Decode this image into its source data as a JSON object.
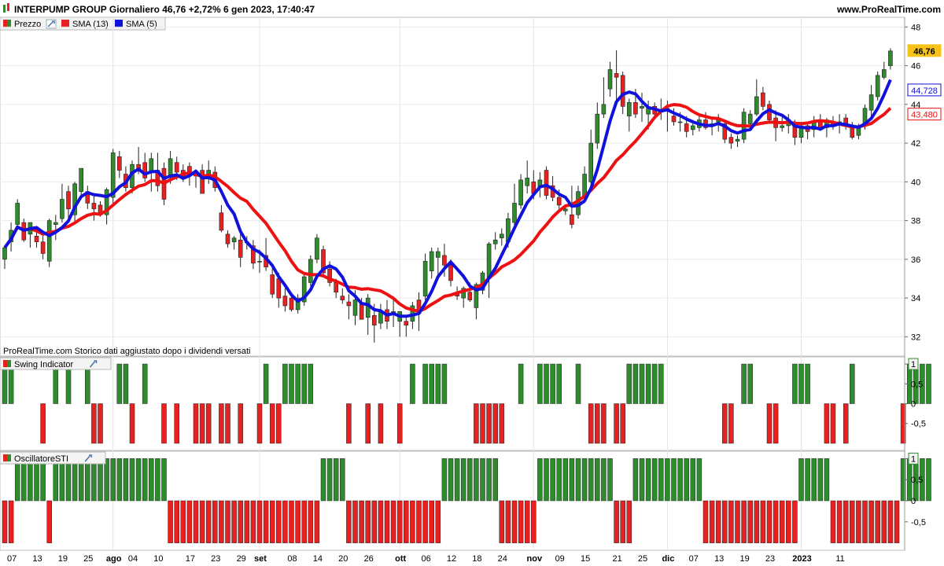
{
  "header": {
    "title": "INTERPUMP GROUP Giornaliero 46,76 +2,72% 6 gen 2023, 17:40:47",
    "site": "www.ProRealTime.com"
  },
  "legend": {
    "prezzo": "Prezzo",
    "sma13": "SMA (13)",
    "sma5": "SMA (5)"
  },
  "footnote": "ProRealTime.com  Storico dati aggiustato dopo i dividendi versati",
  "colors": {
    "up": "#2e8b2e",
    "down": "#e82020",
    "sma13": "#ee1111",
    "sma5": "#1111dd",
    "last_price_bg": "#f7c21a"
  },
  "chart_data": [
    {
      "type": "candlestick",
      "title": "INTERPUMP GROUP Giornaliero",
      "ylim": [
        31,
        48.5
      ],
      "y_ticks": [
        "48",
        "46",
        "44",
        "42",
        "40",
        "38",
        "36",
        "34",
        "32"
      ],
      "last_price_label": "46,76",
      "sma5_label": "44,728",
      "sma13_label": "43,480",
      "x_tick_labels": [
        "07",
        "13",
        "19",
        "25",
        "ago",
        "04",
        "10",
        "17",
        "23",
        "29",
        "set",
        "08",
        "14",
        "20",
        "26",
        "ott",
        "06",
        "12",
        "18",
        "24",
        "nov",
        "09",
        "15",
        "21",
        "25",
        "dic",
        "07",
        "13",
        "19",
        "23",
        "2023",
        "11"
      ],
      "candles": [
        {
          "o": 36.0,
          "h": 36.6,
          "l": 35.5,
          "c": 36.6
        },
        {
          "o": 36.9,
          "h": 37.9,
          "l": 36.4,
          "c": 37.5
        },
        {
          "o": 37.8,
          "h": 39.1,
          "l": 37.5,
          "c": 38.9
        },
        {
          "o": 37.9,
          "h": 38.1,
          "l": 36.9,
          "c": 37.0
        },
        {
          "o": 37.3,
          "h": 37.9,
          "l": 36.6,
          "c": 37.9
        },
        {
          "o": 37.2,
          "h": 37.5,
          "l": 36.6,
          "c": 36.9
        },
        {
          "o": 36.9,
          "h": 37.3,
          "l": 36.0,
          "c": 36.3
        },
        {
          "o": 35.9,
          "h": 38.1,
          "l": 35.6,
          "c": 38.0
        },
        {
          "o": 37.8,
          "h": 38.3,
          "l": 37.0,
          "c": 37.9
        },
        {
          "o": 38.1,
          "h": 39.9,
          "l": 37.9,
          "c": 39.1
        },
        {
          "o": 39.5,
          "h": 39.8,
          "l": 38.1,
          "c": 38.6
        },
        {
          "o": 38.3,
          "h": 40.0,
          "l": 37.8,
          "c": 39.9
        },
        {
          "o": 39.5,
          "h": 40.7,
          "l": 39.1,
          "c": 40.7
        },
        {
          "o": 39.5,
          "h": 39.8,
          "l": 38.6,
          "c": 38.9
        },
        {
          "o": 38.9,
          "h": 39.3,
          "l": 38.0,
          "c": 38.6
        },
        {
          "o": 38.8,
          "h": 39.0,
          "l": 38.2,
          "c": 38.4
        },
        {
          "o": 38.3,
          "h": 39.7,
          "l": 37.8,
          "c": 39.6
        },
        {
          "o": 39.2,
          "h": 41.7,
          "l": 38.9,
          "c": 41.5
        },
        {
          "o": 41.3,
          "h": 41.6,
          "l": 40.2,
          "c": 40.6
        },
        {
          "o": 40.4,
          "h": 40.8,
          "l": 39.5,
          "c": 39.7
        },
        {
          "o": 39.7,
          "h": 41.1,
          "l": 39.4,
          "c": 40.9
        },
        {
          "o": 40.9,
          "h": 41.8,
          "l": 40.4,
          "c": 40.6
        },
        {
          "o": 41.0,
          "h": 41.5,
          "l": 40.0,
          "c": 40.2
        },
        {
          "o": 40.5,
          "h": 41.5,
          "l": 39.5,
          "c": 41.2
        },
        {
          "o": 40.6,
          "h": 41.5,
          "l": 39.5,
          "c": 39.8
        },
        {
          "o": 40.7,
          "h": 41.0,
          "l": 38.8,
          "c": 39.1
        },
        {
          "o": 40.3,
          "h": 41.6,
          "l": 39.9,
          "c": 41.2
        },
        {
          "o": 41.0,
          "h": 41.3,
          "l": 40.1,
          "c": 40.5
        },
        {
          "o": 40.6,
          "h": 40.9,
          "l": 40.0,
          "c": 40.3
        },
        {
          "o": 40.8,
          "h": 41.0,
          "l": 39.8,
          "c": 40.5
        },
        {
          "o": 40.4,
          "h": 40.6,
          "l": 39.7,
          "c": 40.3
        },
        {
          "o": 40.6,
          "h": 40.9,
          "l": 39.4,
          "c": 39.4
        },
        {
          "o": 40.4,
          "h": 41.1,
          "l": 39.9,
          "c": 40.6
        },
        {
          "o": 40.5,
          "h": 40.8,
          "l": 39.5,
          "c": 39.7
        },
        {
          "o": 38.4,
          "h": 38.8,
          "l": 37.4,
          "c": 37.5
        },
        {
          "o": 37.3,
          "h": 37.5,
          "l": 36.6,
          "c": 36.8
        },
        {
          "o": 36.9,
          "h": 37.2,
          "l": 36.5,
          "c": 37.1
        },
        {
          "o": 37.0,
          "h": 37.3,
          "l": 35.6,
          "c": 36.1
        },
        {
          "o": 36.9,
          "h": 37.2,
          "l": 36.5,
          "c": 36.9
        },
        {
          "o": 36.7,
          "h": 37.0,
          "l": 35.5,
          "c": 35.8
        },
        {
          "o": 35.9,
          "h": 36.5,
          "l": 35.3,
          "c": 35.9
        },
        {
          "o": 36.2,
          "h": 37.1,
          "l": 35.4,
          "c": 35.6
        },
        {
          "o": 35.2,
          "h": 35.6,
          "l": 34.0,
          "c": 34.2
        },
        {
          "o": 35.0,
          "h": 35.3,
          "l": 33.5,
          "c": 34.0
        },
        {
          "o": 34.1,
          "h": 34.5,
          "l": 33.3,
          "c": 33.6
        },
        {
          "o": 34.0,
          "h": 34.3,
          "l": 33.3,
          "c": 33.4
        },
        {
          "o": 33.4,
          "h": 34.2,
          "l": 33.2,
          "c": 34.0
        },
        {
          "o": 33.8,
          "h": 35.3,
          "l": 33.6,
          "c": 35.1
        },
        {
          "o": 34.8,
          "h": 36.2,
          "l": 34.6,
          "c": 36.0
        },
        {
          "o": 36.0,
          "h": 37.3,
          "l": 35.8,
          "c": 37.1
        },
        {
          "o": 36.5,
          "h": 36.7,
          "l": 35.1,
          "c": 35.3
        },
        {
          "o": 35.5,
          "h": 35.9,
          "l": 34.6,
          "c": 34.8
        },
        {
          "o": 34.8,
          "h": 35.0,
          "l": 34.0,
          "c": 34.3
        },
        {
          "o": 34.1,
          "h": 34.5,
          "l": 33.7,
          "c": 33.9
        },
        {
          "o": 33.8,
          "h": 34.2,
          "l": 32.9,
          "c": 33.6
        },
        {
          "o": 33.1,
          "h": 34.4,
          "l": 32.6,
          "c": 33.9
        },
        {
          "o": 33.7,
          "h": 34.0,
          "l": 32.9,
          "c": 32.9
        },
        {
          "o": 33.0,
          "h": 34.2,
          "l": 32.1,
          "c": 34.0
        },
        {
          "o": 33.1,
          "h": 33.7,
          "l": 31.7,
          "c": 32.6
        },
        {
          "o": 32.7,
          "h": 33.7,
          "l": 32.4,
          "c": 33.3
        },
        {
          "o": 33.4,
          "h": 33.9,
          "l": 32.4,
          "c": 32.8
        },
        {
          "o": 33.2,
          "h": 33.9,
          "l": 32.5,
          "c": 33.3
        },
        {
          "o": 32.8,
          "h": 33.3,
          "l": 32.0,
          "c": 33.3
        },
        {
          "o": 32.8,
          "h": 33.0,
          "l": 32.0,
          "c": 32.6
        },
        {
          "o": 32.8,
          "h": 33.8,
          "l": 32.4,
          "c": 33.6
        },
        {
          "o": 33.9,
          "h": 34.3,
          "l": 32.3,
          "c": 33.2
        },
        {
          "o": 34.1,
          "h": 36.3,
          "l": 33.9,
          "c": 35.9
        },
        {
          "o": 35.4,
          "h": 36.6,
          "l": 35.0,
          "c": 36.4
        },
        {
          "o": 36.1,
          "h": 36.6,
          "l": 35.2,
          "c": 36.4
        },
        {
          "o": 36.2,
          "h": 36.8,
          "l": 35.1,
          "c": 35.7
        },
        {
          "o": 35.7,
          "h": 36.0,
          "l": 34.6,
          "c": 34.9
        },
        {
          "o": 34.3,
          "h": 34.6,
          "l": 33.9,
          "c": 34.1
        },
        {
          "o": 34.0,
          "h": 34.6,
          "l": 33.5,
          "c": 34.5
        },
        {
          "o": 34.3,
          "h": 34.8,
          "l": 33.8,
          "c": 33.9
        },
        {
          "o": 33.5,
          "h": 34.8,
          "l": 32.9,
          "c": 34.7
        },
        {
          "o": 34.4,
          "h": 35.4,
          "l": 34.2,
          "c": 35.3
        },
        {
          "o": 35.0,
          "h": 36.9,
          "l": 34.0,
          "c": 36.8
        },
        {
          "o": 36.8,
          "h": 37.4,
          "l": 36.5,
          "c": 37.0
        },
        {
          "o": 37.1,
          "h": 37.6,
          "l": 36.7,
          "c": 37.3
        },
        {
          "o": 36.9,
          "h": 38.4,
          "l": 36.6,
          "c": 38.1
        },
        {
          "o": 37.9,
          "h": 39.9,
          "l": 37.6,
          "c": 38.9
        },
        {
          "o": 38.8,
          "h": 40.4,
          "l": 38.6,
          "c": 40.1
        },
        {
          "o": 39.8,
          "h": 41.1,
          "l": 39.4,
          "c": 40.2
        },
        {
          "o": 40.0,
          "h": 40.6,
          "l": 39.1,
          "c": 39.4
        },
        {
          "o": 39.7,
          "h": 40.5,
          "l": 39.2,
          "c": 40.1
        },
        {
          "o": 40.6,
          "h": 40.8,
          "l": 39.1,
          "c": 39.3
        },
        {
          "o": 39.8,
          "h": 40.3,
          "l": 39.0,
          "c": 39.2
        },
        {
          "o": 39.2,
          "h": 39.6,
          "l": 38.6,
          "c": 38.8
        },
        {
          "o": 38.5,
          "h": 38.8,
          "l": 38.3,
          "c": 38.6
        },
        {
          "o": 38.3,
          "h": 39.8,
          "l": 37.6,
          "c": 37.8
        },
        {
          "o": 38.3,
          "h": 39.8,
          "l": 38.1,
          "c": 39.5
        },
        {
          "o": 39.3,
          "h": 40.8,
          "l": 38.9,
          "c": 40.4
        },
        {
          "o": 40.0,
          "h": 42.7,
          "l": 39.8,
          "c": 42.0
        },
        {
          "o": 42.0,
          "h": 44.1,
          "l": 41.7,
          "c": 43.5
        },
        {
          "o": 43.5,
          "h": 45.4,
          "l": 43.3,
          "c": 44.0
        },
        {
          "o": 44.8,
          "h": 46.2,
          "l": 44.4,
          "c": 45.8
        },
        {
          "o": 45.6,
          "h": 46.8,
          "l": 44.1,
          "c": 45.4
        },
        {
          "o": 45.5,
          "h": 45.7,
          "l": 43.5,
          "c": 43.9
        },
        {
          "o": 43.4,
          "h": 44.3,
          "l": 42.6,
          "c": 44.1
        },
        {
          "o": 44.1,
          "h": 44.8,
          "l": 43.3,
          "c": 43.5
        },
        {
          "o": 43.8,
          "h": 44.6,
          "l": 43.1,
          "c": 43.9
        },
        {
          "o": 43.5,
          "h": 44.2,
          "l": 42.7,
          "c": 43.8
        },
        {
          "o": 43.9,
          "h": 44.1,
          "l": 43.3,
          "c": 43.5
        },
        {
          "o": 43.7,
          "h": 44.3,
          "l": 43.2,
          "c": 43.6
        },
        {
          "o": 43.8,
          "h": 44.2,
          "l": 42.6,
          "c": 43.8
        },
        {
          "o": 43.4,
          "h": 43.8,
          "l": 42.9,
          "c": 43.1
        },
        {
          "o": 43.1,
          "h": 43.6,
          "l": 42.6,
          "c": 43.1
        },
        {
          "o": 43.0,
          "h": 43.4,
          "l": 42.3,
          "c": 42.6
        },
        {
          "o": 42.7,
          "h": 43.2,
          "l": 42.4,
          "c": 42.9
        },
        {
          "o": 42.8,
          "h": 43.4,
          "l": 42.6,
          "c": 43.2
        },
        {
          "o": 43.2,
          "h": 43.6,
          "l": 42.7,
          "c": 42.8
        },
        {
          "o": 42.9,
          "h": 43.3,
          "l": 42.4,
          "c": 43.0
        },
        {
          "o": 43.1,
          "h": 43.5,
          "l": 42.6,
          "c": 43.2
        },
        {
          "o": 43.0,
          "h": 43.1,
          "l": 42.0,
          "c": 42.2
        },
        {
          "o": 42.3,
          "h": 42.5,
          "l": 41.7,
          "c": 42.0
        },
        {
          "o": 42.1,
          "h": 42.4,
          "l": 41.8,
          "c": 42.2
        },
        {
          "o": 42.2,
          "h": 43.8,
          "l": 42.0,
          "c": 43.6
        },
        {
          "o": 43.0,
          "h": 43.7,
          "l": 42.8,
          "c": 43.5
        },
        {
          "o": 43.5,
          "h": 45.3,
          "l": 43.4,
          "c": 44.4
        },
        {
          "o": 44.6,
          "h": 44.9,
          "l": 43.7,
          "c": 43.9
        },
        {
          "o": 44.0,
          "h": 44.2,
          "l": 43.0,
          "c": 43.2
        },
        {
          "o": 43.3,
          "h": 43.7,
          "l": 42.1,
          "c": 42.8
        },
        {
          "o": 42.8,
          "h": 43.4,
          "l": 42.6,
          "c": 42.9
        },
        {
          "o": 42.9,
          "h": 43.5,
          "l": 42.5,
          "c": 43.2
        },
        {
          "o": 43.0,
          "h": 43.2,
          "l": 41.9,
          "c": 42.3
        },
        {
          "o": 42.3,
          "h": 43.1,
          "l": 42.0,
          "c": 42.9
        },
        {
          "o": 42.9,
          "h": 43.1,
          "l": 42.2,
          "c": 42.6
        },
        {
          "o": 42.7,
          "h": 43.4,
          "l": 42.3,
          "c": 43.1
        },
        {
          "o": 43.2,
          "h": 43.5,
          "l": 42.7,
          "c": 42.7
        },
        {
          "o": 42.8,
          "h": 43.3,
          "l": 42.3,
          "c": 43.2
        },
        {
          "o": 43.1,
          "h": 43.4,
          "l": 42.7,
          "c": 42.9
        },
        {
          "o": 43.0,
          "h": 43.5,
          "l": 42.5,
          "c": 43.1
        },
        {
          "o": 43.3,
          "h": 43.5,
          "l": 42.7,
          "c": 42.9
        },
        {
          "o": 42.8,
          "h": 43.1,
          "l": 42.2,
          "c": 42.3
        },
        {
          "o": 42.4,
          "h": 43.0,
          "l": 42.2,
          "c": 42.9
        },
        {
          "o": 42.9,
          "h": 44.0,
          "l": 42.7,
          "c": 43.8
        },
        {
          "o": 43.7,
          "h": 45.0,
          "l": 43.3,
          "c": 44.5
        },
        {
          "o": 44.4,
          "h": 45.7,
          "l": 44.2,
          "c": 45.5
        },
        {
          "o": 45.4,
          "h": 46.2,
          "l": 45.3,
          "c": 45.8
        },
        {
          "o": 46.0,
          "h": 46.9,
          "l": 45.8,
          "c": 46.76
        }
      ],
      "sma13_line_hint": "SMA (13)",
      "sma5_line_hint": "SMA (5)"
    },
    {
      "type": "bar",
      "title": "Swing Indicator",
      "ylim": [
        -1.1,
        1.1
      ],
      "y_ticks": [
        "1",
        "0,5",
        "0",
        "-0,5"
      ],
      "values": [
        1,
        1,
        0,
        0,
        0,
        0,
        -1,
        0,
        1,
        0,
        1,
        0,
        0,
        1,
        -1,
        -1,
        0,
        0,
        1,
        1,
        -1,
        0,
        1,
        0,
        0,
        -1,
        0,
        -1,
        0,
        0,
        -1,
        -1,
        -1,
        0,
        -1,
        -1,
        0,
        -1,
        0,
        0,
        -1,
        1,
        -1,
        -1,
        1,
        1,
        1,
        1,
        1,
        0,
        0,
        0,
        0,
        0,
        -1,
        0,
        0,
        -1,
        0,
        -1,
        0,
        0,
        -1,
        0,
        1,
        0,
        1,
        1,
        1,
        1,
        0,
        0,
        0,
        0,
        -1,
        -1,
        -1,
        -1,
        -1,
        0,
        0,
        1,
        0,
        0,
        1,
        1,
        1,
        1,
        0,
        0,
        1,
        0,
        -1,
        -1,
        -1,
        0,
        -1,
        -1,
        1,
        1,
        1,
        1,
        1,
        1,
        0,
        0,
        0,
        0,
        0,
        0,
        0,
        0,
        0,
        -1,
        -1,
        0,
        1,
        1,
        0,
        0,
        -1,
        -1,
        0,
        0,
        1,
        1,
        1,
        0,
        0,
        -1,
        -1,
        0,
        -1,
        1,
        0,
        0,
        0,
        0,
        0,
        0,
        0,
        -1,
        1,
        1,
        1,
        1
      ]
    },
    {
      "type": "bar",
      "title": "OscillatoreSTI",
      "ylim": [
        -1.1,
        1.1
      ],
      "y_ticks": [
        "1",
        "0,5",
        "0",
        "-0,5"
      ],
      "values": [
        -1,
        -1,
        1,
        1,
        1,
        1,
        1,
        -1,
        1,
        1,
        1,
        1,
        1,
        1,
        1,
        1,
        1,
        1,
        1,
        1,
        1,
        1,
        1,
        1,
        1,
        1,
        -1,
        -1,
        -1,
        -1,
        -1,
        -1,
        -1,
        -1,
        -1,
        -1,
        -1,
        -1,
        -1,
        -1,
        -1,
        -1,
        -1,
        -1,
        -1,
        -1,
        -1,
        -1,
        -1,
        -1,
        1,
        1,
        1,
        1,
        -1,
        -1,
        -1,
        -1,
        -1,
        -1,
        -1,
        -1,
        -1,
        -1,
        -1,
        -1,
        -1,
        -1,
        -1,
        1,
        1,
        1,
        1,
        1,
        1,
        1,
        1,
        1,
        -1,
        -1,
        -1,
        -1,
        -1,
        -1,
        1,
        1,
        1,
        1,
        1,
        1,
        1,
        1,
        1,
        1,
        1,
        1,
        -1,
        -1,
        -1,
        1,
        1,
        1,
        1,
        1,
        1,
        1,
        1,
        1,
        1,
        1,
        -1,
        -1,
        -1,
        -1,
        -1,
        -1,
        -1,
        -1,
        -1,
        -1,
        -1,
        -1,
        -1,
        -1,
        -1,
        1,
        1,
        1,
        1,
        1,
        -1,
        -1,
        -1,
        -1,
        -1,
        -1,
        -1,
        -1,
        -1,
        -1,
        -1,
        1,
        1,
        1,
        1,
        1
      ]
    }
  ]
}
